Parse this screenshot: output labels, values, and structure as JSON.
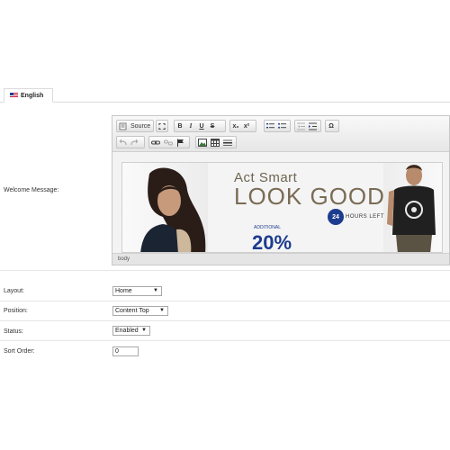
{
  "tabs": [
    {
      "label": "English",
      "flag": "us-flag-icon"
    }
  ],
  "form": {
    "welcome_label": "Welcome Message:",
    "layout_label": "Layout:",
    "layout_value": "Home",
    "position_label": "Position:",
    "position_value": "Content Top",
    "status_label": "Status:",
    "status_value": "Enabled",
    "sort_label": "Sort Order:",
    "sort_value": "0"
  },
  "editor": {
    "source_label": "Source",
    "status_path": "body",
    "toolbar_row1": [
      "maximize-icon",
      "bold-icon",
      "italic-icon",
      "underline-icon",
      "strikethrough-icon",
      "subscript-icon",
      "superscript-icon",
      "numbered-list-icon",
      "bulleted-list-icon",
      "outdent-icon",
      "indent-icon",
      "special-char-icon"
    ],
    "toolbar_row2": [
      "undo-icon",
      "redo-icon",
      "link-icon",
      "unlink-icon",
      "anchor-icon",
      "image-icon",
      "table-icon",
      "horizontal-rule-icon"
    ],
    "glyphs": {
      "bold": "B",
      "italic": "I",
      "underline": "U",
      "strike": "S",
      "sub": "x₂",
      "sup": "x²",
      "omega": "Ω"
    }
  },
  "banner": {
    "line1": "Act Smart",
    "line2": "LOOK GOOD",
    "badge": "24",
    "badge_text": "HOURS LEFT",
    "additional": "ADDITIONAL",
    "discount": "20%"
  },
  "colors": {
    "banner_blue": "#1d3c8f",
    "banner_brown": "#7a6b55"
  }
}
